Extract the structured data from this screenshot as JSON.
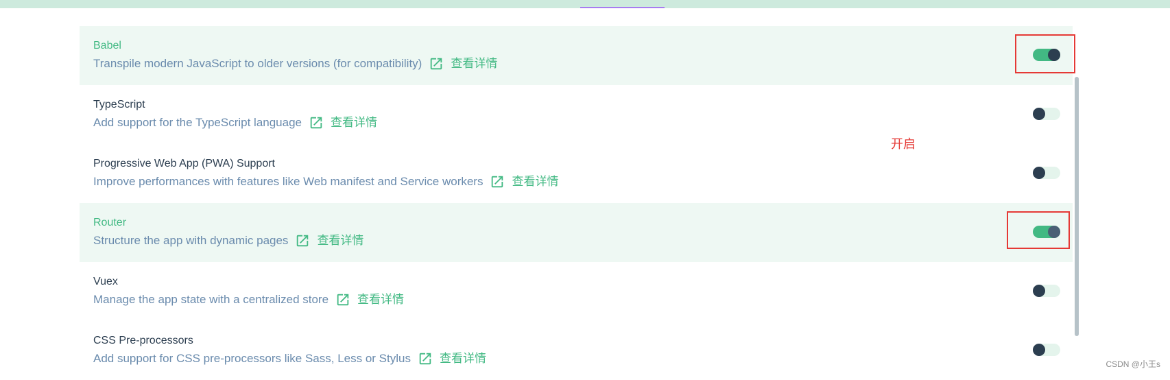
{
  "header": {
    "accent_color": "#a77cf0",
    "bar_color": "#cdeadd"
  },
  "features": [
    {
      "name": "Babel",
      "description": "Transpile modern JavaScript to older versions (for compatibility)",
      "more_info": "查看详情",
      "enabled": true
    },
    {
      "name": "TypeScript",
      "description": "Add support for the TypeScript language",
      "more_info": "查看详情",
      "enabled": false
    },
    {
      "name": "Progressive Web App (PWA) Support",
      "description": "Improve performances with features like Web manifest and Service workers",
      "more_info": "查看详情",
      "enabled": false
    },
    {
      "name": "Router",
      "description": "Structure the app with dynamic pages",
      "more_info": "查看详情",
      "enabled": true
    },
    {
      "name": "Vuex",
      "description": "Manage the app state with a centralized store",
      "more_info": "查看详情",
      "enabled": false
    },
    {
      "name": "CSS Pre-processors",
      "description": "Add support for CSS pre-processors like Sass, Less or Stylus",
      "more_info": "查看详情",
      "enabled": false
    }
  ],
  "annotation": {
    "label": "开启",
    "color": "#e53935"
  },
  "watermark": "CSDN @小王s",
  "colors": {
    "accent_green": "#42b983",
    "text_dark": "#2c3e50",
    "desc_blue": "#6a8bad",
    "selected_bg": "#eef8f3"
  }
}
